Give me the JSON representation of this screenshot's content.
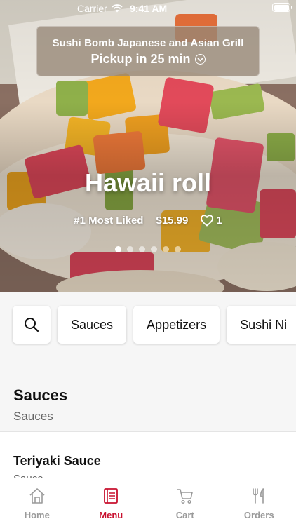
{
  "status_bar": {
    "carrier": "Carrier",
    "time": "9:41 AM"
  },
  "store": {
    "name": "Sushi Bomb Japanese and Asian Grill",
    "pickup": "Pickup in 25 min"
  },
  "featured": {
    "title": "Hawaii roll",
    "rank": "#1 Most Liked",
    "price": "$15.99",
    "likes": "1",
    "slide_count": 6,
    "active_slide": 1
  },
  "categories": {
    "items": [
      "Sauces",
      "Appetizers",
      "Sushi Ni"
    ]
  },
  "section": {
    "title": "Sauces",
    "subtitle": "Sauces"
  },
  "menu_item": {
    "name": "Teriyaki Sauce",
    "description": "Sauce"
  },
  "tabs": [
    {
      "label": "Home",
      "icon": "home-icon",
      "active": false
    },
    {
      "label": "Menu",
      "icon": "menu-icon",
      "active": true
    },
    {
      "label": "Cart",
      "icon": "cart-icon",
      "active": false
    },
    {
      "label": "Orders",
      "icon": "orders-icon",
      "active": false
    }
  ],
  "colors": {
    "accent": "#c8102e",
    "inactive_tab": "#9a9a9a"
  }
}
